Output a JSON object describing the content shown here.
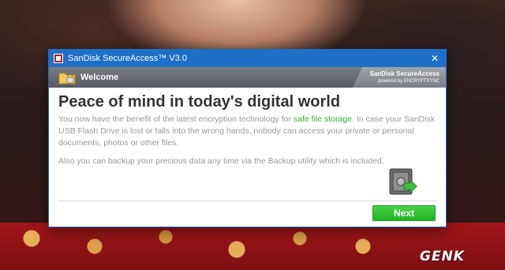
{
  "window": {
    "title": "SanDisk SecureAccess™ V3.0",
    "close_glyph": "✕"
  },
  "header": {
    "title": "Welcome",
    "brand_name": "SanDisk SecureAccess",
    "brand_powered": "powered by ENCRYPTSYNC"
  },
  "content": {
    "headline": "Peace of mind in today's digital world",
    "para1_before": "You now have the benefit of the latest encryption technology for ",
    "para1_highlight": "safe file storage",
    "para1_after": ". In case your SanDisk USB Flash Drive is lost or falls into the wrong hands, nobody can access your private or personal documents, photos or other files.",
    "para2": "Also you can backup your precious data any time via the Backup utility which is included."
  },
  "footer": {
    "next_label": "Next"
  },
  "watermark": {
    "text": "GENK"
  },
  "colors": {
    "titlebar": "#1e6fc8",
    "highlight": "#39a93b",
    "next_button": "#2fbf2f"
  },
  "icons": {
    "app": "sandisk-icon",
    "welcome": "folder-lock-icon",
    "close": "close-icon",
    "vault": "vault-arrow-icon"
  }
}
